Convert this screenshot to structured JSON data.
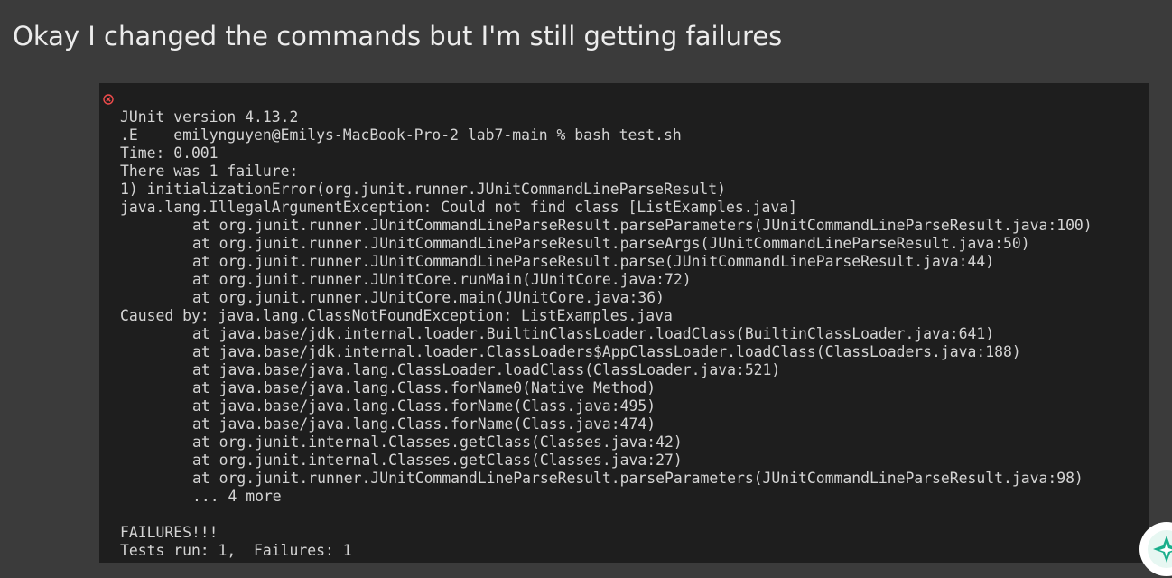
{
  "post": {
    "title": "Okay I changed the commands but I'm still getting failures"
  },
  "terminal": {
    "prompt_line": "emilynguyen@Emilys-MacBook-Pro-2 lab7-main % bash test.sh",
    "status_icon": "error-circle-x-icon",
    "colors": {
      "background": "#1e1e1e",
      "text": "#d4d4d4",
      "error": "#f14c4c"
    },
    "output": [
      {
        "text": "JUnit version 4.13.2",
        "indent": false
      },
      {
        "text": ".E",
        "indent": false
      },
      {
        "text": "Time: 0.001",
        "indent": false
      },
      {
        "text": "There was 1 failure:",
        "indent": false
      },
      {
        "text": "1) initializationError(org.junit.runner.JUnitCommandLineParseResult)",
        "indent": false
      },
      {
        "text": "java.lang.IllegalArgumentException: Could not find class [ListExamples.java]",
        "indent": false
      },
      {
        "text": "at org.junit.runner.JUnitCommandLineParseResult.parseParameters(JUnitCommandLineParseResult.java:100)",
        "indent": true
      },
      {
        "text": "at org.junit.runner.JUnitCommandLineParseResult.parseArgs(JUnitCommandLineParseResult.java:50)",
        "indent": true
      },
      {
        "text": "at org.junit.runner.JUnitCommandLineParseResult.parse(JUnitCommandLineParseResult.java:44)",
        "indent": true
      },
      {
        "text": "at org.junit.runner.JUnitCore.runMain(JUnitCore.java:72)",
        "indent": true
      },
      {
        "text": "at org.junit.runner.JUnitCore.main(JUnitCore.java:36)",
        "indent": true
      },
      {
        "text": "Caused by: java.lang.ClassNotFoundException: ListExamples.java",
        "indent": false
      },
      {
        "text": "at java.base/jdk.internal.loader.BuiltinClassLoader.loadClass(BuiltinClassLoader.java:641)",
        "indent": true
      },
      {
        "text": "at java.base/jdk.internal.loader.ClassLoaders$AppClassLoader.loadClass(ClassLoaders.java:188)",
        "indent": true
      },
      {
        "text": "at java.base/java.lang.ClassLoader.loadClass(ClassLoader.java:521)",
        "indent": true
      },
      {
        "text": "at java.base/java.lang.Class.forName0(Native Method)",
        "indent": true
      },
      {
        "text": "at java.base/java.lang.Class.forName(Class.java:495)",
        "indent": true
      },
      {
        "text": "at java.base/java.lang.Class.forName(Class.java:474)",
        "indent": true
      },
      {
        "text": "at org.junit.internal.Classes.getClass(Classes.java:42)",
        "indent": true
      },
      {
        "text": "at org.junit.internal.Classes.getClass(Classes.java:27)",
        "indent": true
      },
      {
        "text": "at org.junit.runner.JUnitCommandLineParseResult.parseParameters(JUnitCommandLineParseResult.java:98)",
        "indent": true
      },
      {
        "text": "... 4 more",
        "indent": true
      },
      {
        "text": "",
        "indent": false
      },
      {
        "text": "FAILURES!!!",
        "indent": false
      },
      {
        "text": "Tests run: 1,  Failures: 1",
        "indent": false
      }
    ]
  },
  "floating_button": {
    "icon": "assistant-sparkle-icon",
    "color": "#1aae8c"
  }
}
